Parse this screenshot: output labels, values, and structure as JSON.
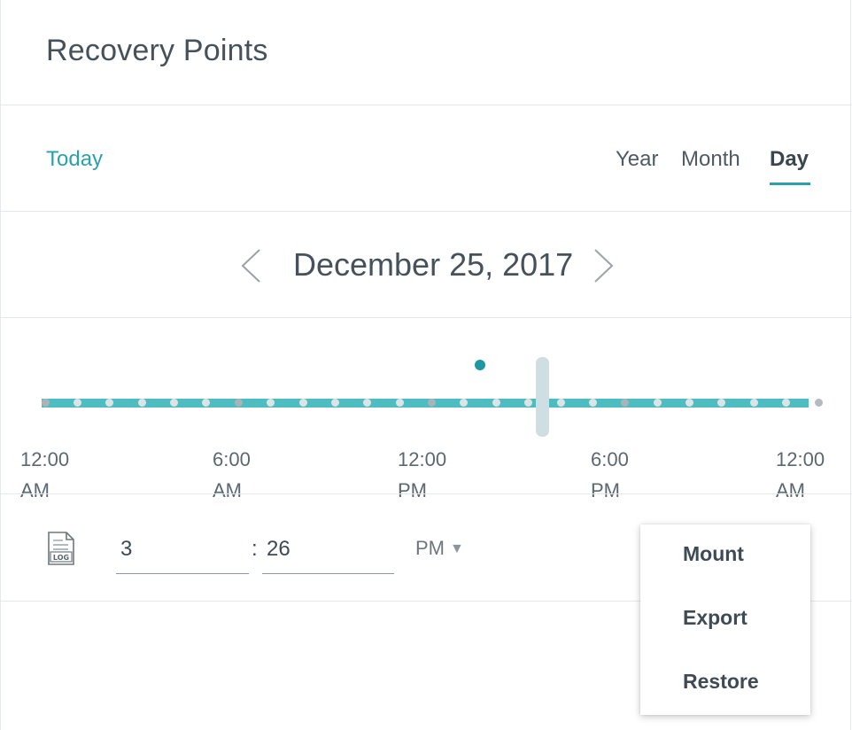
{
  "header": {
    "title": "Recovery Points"
  },
  "nav": {
    "today_label": "Today",
    "tabs": [
      {
        "label": "Year"
      },
      {
        "label": "Month"
      },
      {
        "label": "Day",
        "active": true
      }
    ]
  },
  "date_nav": {
    "date": "December 25, 2017"
  },
  "timeline": {
    "axis_labels": [
      {
        "line1": "12:00",
        "line2": "AM"
      },
      {
        "line1": "6:00",
        "line2": "AM"
      },
      {
        "line1": "12:00",
        "line2": "PM"
      },
      {
        "line1": "6:00",
        "line2": "PM"
      },
      {
        "line1": "12:00",
        "line2": "AM"
      }
    ],
    "snapshot_time_hours": 13.5,
    "handle_time_hours": 15.43
  },
  "time_picker": {
    "hour": "3",
    "separator": ":",
    "minute": "26",
    "period": "PM"
  },
  "actions_menu": {
    "items": [
      {
        "label": "Mount"
      },
      {
        "label": "Export"
      },
      {
        "label": "Restore"
      }
    ]
  },
  "colors": {
    "accent": "#2aa2ad",
    "track": "#4ebdc2",
    "snapshot": "#1e98a2"
  },
  "icons": {
    "prev": "chevron-left-icon",
    "next": "chevron-right-icon",
    "log": "log-file-icon",
    "caret": "caret-down-icon"
  }
}
